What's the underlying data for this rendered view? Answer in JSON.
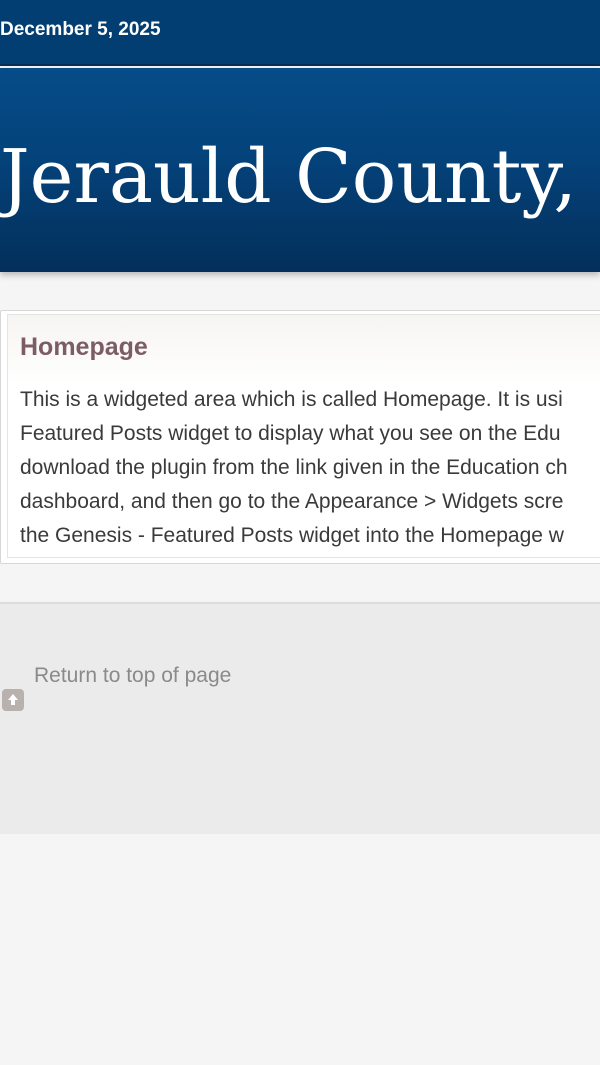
{
  "topbar": {
    "date": "December 5, 2025"
  },
  "header": {
    "site_title": "Jerauld County, S"
  },
  "widget": {
    "title": "Homepage",
    "lines": [
      "This is a widgeted area which is called Homepage. It is usi",
      "Featured Posts widget to display what you see on the Edu",
      "download the plugin from the link given in the Education ch",
      "dashboard, and then go to the Appearance > Widgets scre",
      "the Genesis - Featured Posts widget into the Homepage w"
    ]
  },
  "footer": {
    "return_link": "Return to top of page",
    "icon": "arrow-up-icon"
  }
}
